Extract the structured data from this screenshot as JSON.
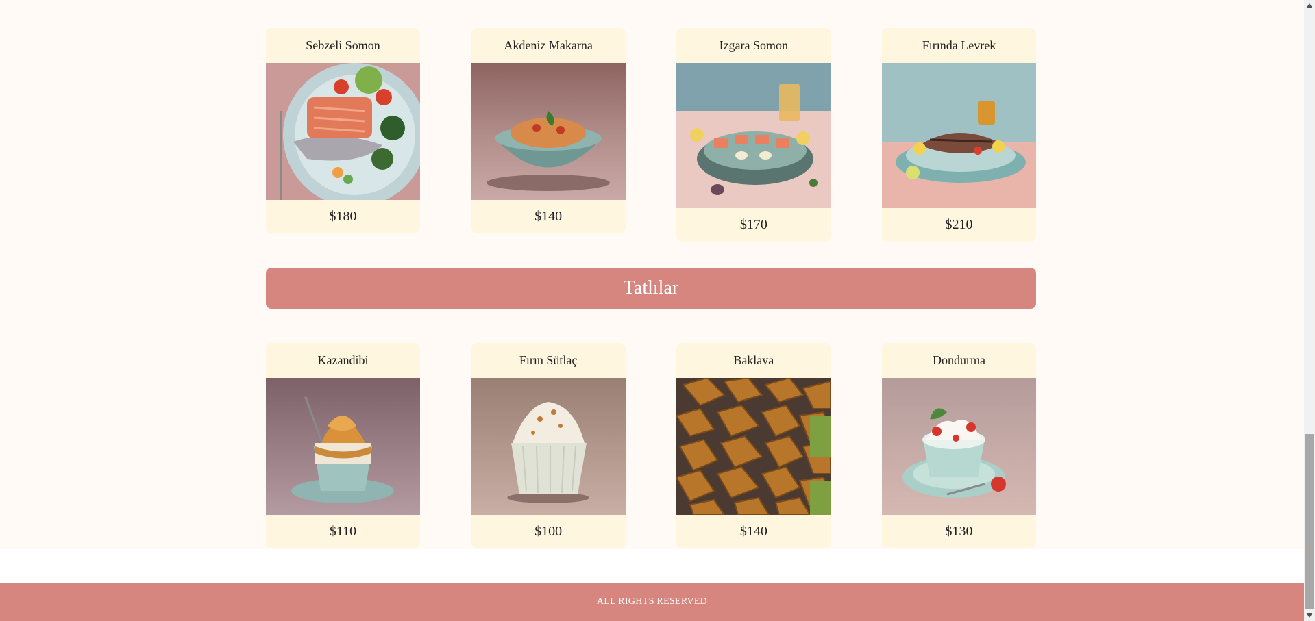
{
  "colors": {
    "page_background": "#fffaf6",
    "card_background": "#fff6df",
    "accent": "#d6867e",
    "text": "#222222"
  },
  "menu": {
    "row1": [
      {
        "name": "Sebzeli Somon",
        "price": "$180",
        "image": "salmon-vegetables-plate"
      },
      {
        "name": "Akdeniz Makarna",
        "price": "$140",
        "image": "pasta-bowl"
      },
      {
        "name": "Izgara Somon",
        "price": "$170",
        "image": "grilled-salmon-pan"
      },
      {
        "name": "Fırında Levrek",
        "price": "$210",
        "image": "baked-sea-bass-plate"
      }
    ],
    "section_title": "Tatlılar",
    "row2": [
      {
        "name": "Kazandibi",
        "price": "$110",
        "image": "caramel-dessert-cup"
      },
      {
        "name": "Fırın Sütlaç",
        "price": "$100",
        "image": "rice-pudding-cup"
      },
      {
        "name": "Baklava",
        "price": "$140",
        "image": "baklava-tray"
      },
      {
        "name": "Dondurma",
        "price": "$130",
        "image": "ice-cream-cup"
      }
    ]
  },
  "footer": {
    "text": "ALL RIGHTS RESERVED"
  }
}
